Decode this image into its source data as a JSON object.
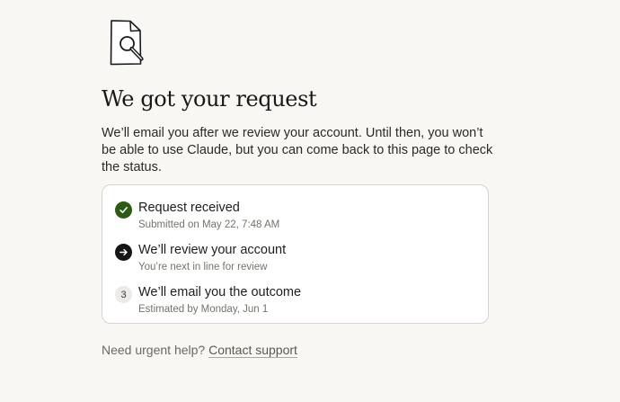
{
  "hero": {
    "icon": "document-magnifier-icon",
    "title": "We got your request",
    "description": "We’ll email you after we review your account. Until then, you won’t be able to use Claude, but you can come back to this page to check the status."
  },
  "steps": [
    {
      "state": "done",
      "icon": "check-icon",
      "title": "Request received",
      "subtitle": "Submitted on May 22, 7:48 AM"
    },
    {
      "state": "current",
      "icon": "arrow-right-icon",
      "title": "We’ll review your account",
      "subtitle": "You’re next in line for review"
    },
    {
      "state": "pending",
      "number": "3",
      "title": "We’ll email you the outcome",
      "subtitle": "Estimated by Monday, Jun 1"
    }
  ],
  "help": {
    "prefix": "Need urgent help?",
    "link_label": "Contact support"
  },
  "colors": {
    "background": "#f8f7f4",
    "done_icon": "#2e5a16",
    "current_icon": "#151515",
    "card_border": "#d6d4cd"
  }
}
